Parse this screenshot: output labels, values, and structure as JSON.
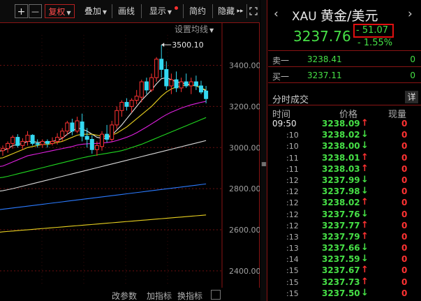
{
  "toolbar": {
    "plus": "+",
    "minus": "—",
    "fuquan": "复权",
    "diejia": "叠加",
    "huaxian": "画线",
    "xianshi": "显示",
    "jianyue": "简约",
    "yincang": "隐藏",
    "more": "▸▸"
  },
  "ma_settings": "设置均线",
  "axis": {
    "ticks": [
      "3400.00",
      "3200.00",
      "3000.00",
      "2800.00",
      "2600.00",
      "2400.00"
    ]
  },
  "annotation_high": "3500.10",
  "bottom_bar": {
    "gaicanshu": "改参数",
    "jiazhibiao": "加指标",
    "huanzhibiao": "换指标"
  },
  "chart_data": {
    "type": "candlestick",
    "y_ticks": [
      3400,
      3200,
      3000,
      2800,
      2600,
      2400
    ],
    "y_range": [
      2320,
      3580
    ],
    "high_annotation": 3500.1,
    "candles": [
      {
        "o": 2985,
        "h": 3010,
        "l": 2960,
        "c": 2995
      },
      {
        "o": 2995,
        "h": 3030,
        "l": 2975,
        "c": 3020
      },
      {
        "o": 3020,
        "h": 3060,
        "l": 2995,
        "c": 3050
      },
      {
        "o": 3050,
        "h": 3065,
        "l": 3000,
        "c": 3010
      },
      {
        "o": 3010,
        "h": 3045,
        "l": 2990,
        "c": 3030
      },
      {
        "o": 3030,
        "h": 3080,
        "l": 3010,
        "c": 3060
      },
      {
        "o": 3060,
        "h": 3065,
        "l": 3010,
        "c": 3020
      },
      {
        "o": 3020,
        "h": 3040,
        "l": 3000,
        "c": 3015
      },
      {
        "o": 3015,
        "h": 3040,
        "l": 3000,
        "c": 3030
      },
      {
        "o": 3030,
        "h": 3040,
        "l": 3000,
        "c": 3020
      },
      {
        "o": 3020,
        "h": 3050,
        "l": 3010,
        "c": 3030
      },
      {
        "o": 3030,
        "h": 3070,
        "l": 3015,
        "c": 3050
      },
      {
        "o": 3050,
        "h": 3095,
        "l": 3030,
        "c": 3080
      },
      {
        "o": 3080,
        "h": 3130,
        "l": 3060,
        "c": 3120
      },
      {
        "o": 3120,
        "h": 3140,
        "l": 3060,
        "c": 3080
      },
      {
        "o": 3080,
        "h": 3150,
        "l": 3070,
        "c": 3130
      },
      {
        "o": 3125,
        "h": 3165,
        "l": 3030,
        "c": 3055
      },
      {
        "o": 3055,
        "h": 3095,
        "l": 3000,
        "c": 3040
      },
      {
        "o": 3040,
        "h": 3060,
        "l": 2970,
        "c": 2990
      },
      {
        "o": 2990,
        "h": 3030,
        "l": 2960,
        "c": 3010
      },
      {
        "o": 3005,
        "h": 3080,
        "l": 2985,
        "c": 3065
      },
      {
        "o": 3065,
        "h": 3110,
        "l": 3025,
        "c": 3040
      },
      {
        "o": 3040,
        "h": 3130,
        "l": 3030,
        "c": 3110
      },
      {
        "o": 3110,
        "h": 3200,
        "l": 3090,
        "c": 3180
      },
      {
        "o": 3180,
        "h": 3230,
        "l": 3150,
        "c": 3220
      },
      {
        "o": 3220,
        "h": 3240,
        "l": 3180,
        "c": 3200
      },
      {
        "o": 3200,
        "h": 3240,
        "l": 3170,
        "c": 3230
      },
      {
        "o": 3230,
        "h": 3280,
        "l": 3210,
        "c": 3250
      },
      {
        "o": 3245,
        "h": 3330,
        "l": 3220,
        "c": 3320
      },
      {
        "o": 3320,
        "h": 3340,
        "l": 3260,
        "c": 3280
      },
      {
        "o": 3280,
        "h": 3360,
        "l": 3270,
        "c": 3340
      },
      {
        "o": 3340,
        "h": 3440,
        "l": 3320,
        "c": 3430
      },
      {
        "o": 3430,
        "h": 3500,
        "l": 3340,
        "c": 3380
      },
      {
        "o": 3380,
        "h": 3420,
        "l": 3280,
        "c": 3300
      },
      {
        "o": 3300,
        "h": 3360,
        "l": 3260,
        "c": 3330
      },
      {
        "o": 3330,
        "h": 3370,
        "l": 3270,
        "c": 3290
      },
      {
        "o": 3290,
        "h": 3340,
        "l": 3270,
        "c": 3320
      },
      {
        "o": 3320,
        "h": 3360,
        "l": 3290,
        "c": 3300
      },
      {
        "o": 3300,
        "h": 3340,
        "l": 3260,
        "c": 3320
      },
      {
        "o": 3320,
        "h": 3350,
        "l": 3280,
        "c": 3300
      },
      {
        "o": 3300,
        "h": 3325,
        "l": 3260,
        "c": 3270
      },
      {
        "o": 3275,
        "h": 3300,
        "l": 3215,
        "c": 3238
      }
    ],
    "series": [
      {
        "color": "#e8e8e8",
        "values": [
          2985,
          2995,
          3010,
          3015,
          3020,
          3030,
          3030,
          3025,
          3025,
          3025,
          3030,
          3035,
          3045,
          3065,
          3080,
          3095,
          3090,
          3080,
          3065,
          3050,
          3045,
          3045,
          3060,
          3085,
          3110,
          3140,
          3170,
          3200,
          3230,
          3255,
          3280,
          3310,
          3335,
          3340,
          3330,
          3320,
          3315,
          3310,
          3305,
          3300,
          3290,
          3275
        ]
      },
      {
        "color": "#e8d020",
        "values": [
          2950,
          2960,
          2970,
          2980,
          2990,
          3000,
          3005,
          3010,
          3015,
          3015,
          3020,
          3025,
          3030,
          3040,
          3050,
          3060,
          3065,
          3065,
          3065,
          3060,
          3055,
          3055,
          3060,
          3070,
          3085,
          3100,
          3120,
          3140,
          3160,
          3180,
          3200,
          3225,
          3250,
          3270,
          3285,
          3295,
          3300,
          3305,
          3305,
          3300,
          3290,
          3280
        ]
      },
      {
        "color": "#e020e0",
        "values": [
          2910,
          2920,
          2930,
          2940,
          2950,
          2960,
          2965,
          2970,
          2975,
          2980,
          2985,
          2990,
          2995,
          3000,
          3005,
          3012,
          3016,
          3018,
          3020,
          3020,
          3022,
          3024,
          3028,
          3034,
          3042,
          3050,
          3060,
          3072,
          3086,
          3100,
          3115,
          3130,
          3146,
          3160,
          3172,
          3182,
          3192,
          3200,
          3208,
          3214,
          3220,
          3225
        ]
      },
      {
        "color": "#20d820",
        "values": [
          2855,
          2860,
          2866,
          2872,
          2878,
          2884,
          2890,
          2896,
          2902,
          2908,
          2914,
          2920,
          2926,
          2932,
          2938,
          2944,
          2950,
          2955,
          2960,
          2964,
          2968,
          2972,
          2976,
          2980,
          2985,
          2992,
          3000,
          3008,
          3016,
          3026,
          3036,
          3046,
          3056,
          3066,
          3076,
          3086,
          3096,
          3106,
          3116,
          3126,
          3136,
          3146
        ]
      },
      {
        "color": "#d8d8d8",
        "values": [
          2790,
          2795,
          2800,
          2806,
          2812,
          2818,
          2824,
          2830,
          2836,
          2842,
          2848,
          2854,
          2860,
          2866,
          2872,
          2878,
          2884,
          2890,
          2896,
          2902,
          2908,
          2914,
          2920,
          2926,
          2932,
          2938,
          2944,
          2950,
          2956,
          2962,
          2968,
          2974,
          2980,
          2986,
          2992,
          2998,
          3004,
          3010,
          3016,
          3022,
          3028,
          3034
        ]
      },
      {
        "color": "#2b7bff",
        "values": [
          2700,
          2703,
          2706,
          2709,
          2712,
          2715,
          2718,
          2721,
          2724,
          2727,
          2730,
          2733,
          2736,
          2739,
          2742,
          2745,
          2748,
          2751,
          2754,
          2757,
          2760,
          2763,
          2766,
          2769,
          2772,
          2775,
          2778,
          2781,
          2784,
          2787,
          2790,
          2793,
          2796,
          2799,
          2802,
          2805,
          2808,
          2811,
          2814,
          2817,
          2820,
          2823
        ]
      },
      {
        "color": "#e8d020",
        "values": [
          2590,
          2592,
          2594,
          2596,
          2598,
          2600,
          2602,
          2604,
          2606,
          2608,
          2610,
          2612,
          2614,
          2616,
          2618,
          2620,
          2622,
          2624,
          2626,
          2628,
          2630,
          2632,
          2634,
          2636,
          2638,
          2640,
          2642,
          2644,
          2646,
          2648,
          2650,
          2652,
          2654,
          2656,
          2658,
          2660,
          2662,
          2664,
          2666,
          2668,
          2670,
          2672
        ]
      }
    ]
  },
  "quote": {
    "nav_left": "‹",
    "nav_right": "›",
    "symbol": "XAU",
    "name_cn": "黄金/美元",
    "price": "3237.76",
    "change": "- 51.07",
    "change_pct": "- 1.55%",
    "sell_label": "卖一",
    "sell_price": "3238.41",
    "sell_vol": "0",
    "buy_label": "买一",
    "buy_price": "3237.11",
    "buy_vol": "0",
    "trades_title": "分时成交",
    "detail": "详",
    "col_time": "时间",
    "col_price": "价格",
    "col_vol": "现量",
    "trades": [
      {
        "time": "09:50",
        "price": "3238.09",
        "dir": "↑",
        "vol": "0"
      },
      {
        "time": ":10",
        "price": "3238.02",
        "dir": "↓",
        "vol": "0"
      },
      {
        "time": ":10",
        "price": "3238.00",
        "dir": "↓",
        "vol": "0"
      },
      {
        "time": ":11",
        "price": "3238.01",
        "dir": "↑",
        "vol": "0"
      },
      {
        "time": ":11",
        "price": "3238.03",
        "dir": "↑",
        "vol": "0"
      },
      {
        "time": ":12",
        "price": "3237.99",
        "dir": "↓",
        "vol": "0"
      },
      {
        "time": ":12",
        "price": "3237.98",
        "dir": "↓",
        "vol": "0"
      },
      {
        "time": ":12",
        "price": "3238.02",
        "dir": "↑",
        "vol": "0"
      },
      {
        "time": ":12",
        "price": "3237.76",
        "dir": "↓",
        "vol": "0"
      },
      {
        "time": ":12",
        "price": "3237.77",
        "dir": "↑",
        "vol": "0"
      },
      {
        "time": ":13",
        "price": "3237.79",
        "dir": "↑",
        "vol": "0"
      },
      {
        "time": ":13",
        "price": "3237.66",
        "dir": "↓",
        "vol": "0"
      },
      {
        "time": ":14",
        "price": "3237.59",
        "dir": "↓",
        "vol": "0"
      },
      {
        "time": ":15",
        "price": "3237.67",
        "dir": "↑",
        "vol": "0"
      },
      {
        "time": ":15",
        "price": "3237.73",
        "dir": "↑",
        "vol": "0"
      },
      {
        "time": ":15",
        "price": "3237.50",
        "dir": "↓",
        "vol": "0"
      }
    ]
  }
}
